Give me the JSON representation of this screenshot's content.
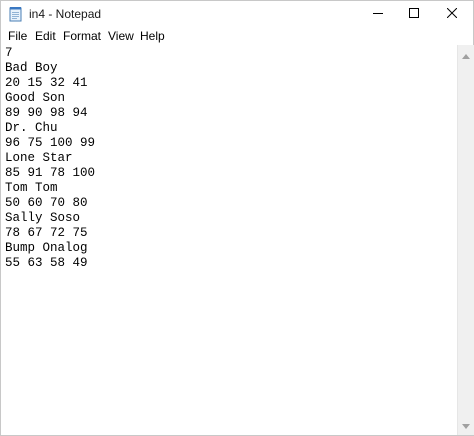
{
  "window": {
    "title": "in4 - Notepad",
    "app_icon": "notepad-icon",
    "controls": {
      "minimize_icon": "minimize-icon",
      "maximize_icon": "maximize-icon",
      "close_icon": "close-icon"
    }
  },
  "menu": {
    "items": [
      {
        "label": "File"
      },
      {
        "label": "Edit"
      },
      {
        "label": "Format"
      },
      {
        "label": "View"
      },
      {
        "label": "Help"
      }
    ]
  },
  "editor": {
    "lines": [
      "7",
      "Bad Boy",
      "20 15 32 41",
      "Good Son",
      "89 90 98 94",
      "Dr. Chu",
      "96 75 100 99",
      "Lone Star",
      "85 91 78 100",
      "Tom Tom",
      "50 60 70 80",
      "Sally Soso",
      "78 67 72 75",
      "Bump Onalog",
      "55 63 58 49"
    ]
  },
  "scrollbar": {
    "up_icon": "scroll-up-arrow-icon",
    "down_icon": "scroll-down-arrow-icon"
  }
}
